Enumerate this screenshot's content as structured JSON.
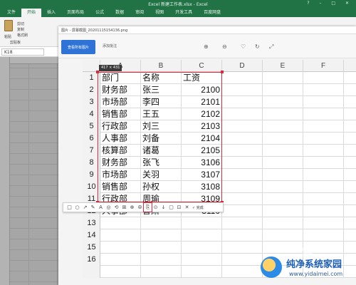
{
  "excel": {
    "title": "Excel 新建工作表.xlsx - Excel",
    "window_controls": "? – □ ✕",
    "tabs": [
      "文件",
      "开始",
      "插入",
      "页面布局",
      "公式",
      "数据",
      "审阅",
      "视图",
      "开发工具",
      "百度网盘"
    ],
    "active_tab_index": 1,
    "namebox": "K18",
    "ribbon": {
      "cut": "剪切",
      "copy": "复制",
      "format_painter": "格式刷",
      "paste": "粘贴",
      "clipboard": "剪贴板"
    }
  },
  "viewer": {
    "title": "图片 - 屏幕截图_20201115154136.png",
    "open_button": "查看所有图片",
    "add_label": "添加批注"
  },
  "capture": {
    "size_label": "417 × 431",
    "columns": [
      "A",
      "B",
      "C",
      "D",
      "E",
      "F"
    ],
    "row_numbers": [
      "1",
      "2",
      "3",
      "4",
      "5",
      "6",
      "7",
      "8",
      "9",
      "10",
      "11",
      "12",
      "13",
      "14",
      "15",
      "16"
    ],
    "headers": [
      "部门",
      "名称",
      "工资"
    ],
    "rows": [
      {
        "dept": "财务部",
        "name": "张三",
        "salary": "2100"
      },
      {
        "dept": "市场部",
        "name": "李四",
        "salary": "2101"
      },
      {
        "dept": "销售部",
        "name": "王五",
        "salary": "2102"
      },
      {
        "dept": "行政部",
        "name": "刘三",
        "salary": "2103"
      },
      {
        "dept": "人事部",
        "name": "刘备",
        "salary": "2104"
      },
      {
        "dept": "核算部",
        "name": "诸葛",
        "salary": "2105"
      },
      {
        "dept": "财务部",
        "name": "张飞",
        "salary": "3106"
      },
      {
        "dept": "市场部",
        "name": "关羽",
        "salary": "3107"
      },
      {
        "dept": "销售部",
        "name": "孙权",
        "salary": "3108"
      },
      {
        "dept": "行政部",
        "name": "周瑜",
        "salary": "3109"
      },
      {
        "dept": "人事部",
        "name": "鲁肃",
        "salary": "3110"
      }
    ]
  },
  "annotation_toolbar": {
    "tools": [
      "□",
      "○",
      "↗",
      "✎",
      "A",
      "◎",
      "⟲",
      "⊞",
      "⊕",
      "⦾",
      "⎘",
      "⊙",
      "↓",
      "▢",
      "⊡",
      "✕"
    ],
    "highlighted_index": 10,
    "done_label": "✓ 完成"
  },
  "watermark": {
    "site": "纯净系统家园",
    "url": "www.yidaimei.com"
  }
}
